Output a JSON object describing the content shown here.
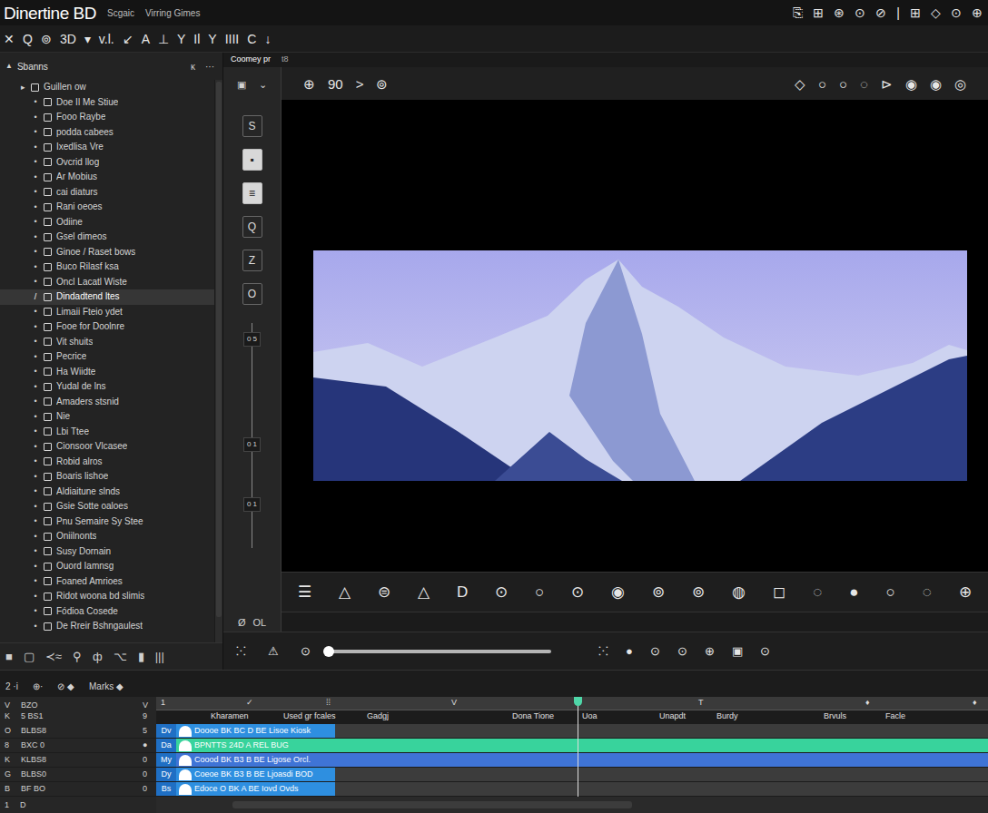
{
  "window": {
    "title": "Dinertine BD",
    "subtitle": "Scgaic",
    "menu": "Virring Gimes",
    "icons": [
      "⎘",
      "⊞",
      "⊛",
      "⊙",
      "⊘",
      "|",
      "⊞",
      "◇",
      "⊙",
      "⊕"
    ]
  },
  "toolbar": [
    "✕",
    "Q",
    "⊚",
    "3D",
    "▾",
    "v.l.",
    "↙",
    "A",
    "⊥",
    "Y",
    "Il",
    "Y",
    "IIII",
    "C",
    "↓"
  ],
  "sidebar": {
    "toggle": "▲",
    "title": "Sbanns",
    "actions": [
      "ĸ",
      "···"
    ],
    "items": [
      {
        "kind": "group",
        "marker": "▸",
        "label": "Guillen ow",
        "selected": false
      },
      {
        "kind": "item",
        "marker": "•",
        "label": "Doe Il Me Stiue",
        "selected": false
      },
      {
        "kind": "item",
        "marker": "•",
        "label": "Fooo Raybe",
        "selected": false
      },
      {
        "kind": "item",
        "marker": "•",
        "label": "podda cabees",
        "selected": false
      },
      {
        "kind": "item",
        "marker": "•",
        "label": "Ixedlisa Vre",
        "selected": false
      },
      {
        "kind": "item",
        "marker": "•",
        "label": "Ovcrid llog",
        "selected": false
      },
      {
        "kind": "item",
        "marker": "•",
        "label": "Ar Mobius",
        "selected": false
      },
      {
        "kind": "item",
        "marker": "•",
        "label": "cai diaturs",
        "selected": false
      },
      {
        "kind": "item",
        "marker": "•",
        "label": "Rani oeoes",
        "selected": false
      },
      {
        "kind": "item",
        "marker": "•",
        "label": "Odiine",
        "selected": false
      },
      {
        "kind": "item",
        "marker": "•",
        "label": "Gsel dimeos",
        "selected": false
      },
      {
        "kind": "item",
        "marker": "•",
        "label": "Ginoe / Raset bows",
        "selected": false
      },
      {
        "kind": "item",
        "marker": "•",
        "label": "Buco Rilasf ksa",
        "selected": false
      },
      {
        "kind": "item",
        "marker": "•",
        "label": "Oncl Lacatl Wiste",
        "selected": false
      },
      {
        "kind": "item",
        "marker": "/",
        "label": "Dindadtend ltes",
        "selected": true
      },
      {
        "kind": "item",
        "marker": "•",
        "label": "Limaii Fteio ydet",
        "selected": false
      },
      {
        "kind": "item",
        "marker": "•",
        "label": "Fooe for Doolnre",
        "selected": false
      },
      {
        "kind": "item",
        "marker": "•",
        "label": "Vit shuits",
        "selected": false
      },
      {
        "kind": "item",
        "marker": "•",
        "label": "Pecrice",
        "selected": false
      },
      {
        "kind": "item",
        "marker": "•",
        "label": "Ha Wiidte",
        "selected": false
      },
      {
        "kind": "item",
        "marker": "•",
        "label": "Yudal de lns",
        "selected": false
      },
      {
        "kind": "item",
        "marker": "•",
        "label": "Amaders stsnid",
        "selected": false
      },
      {
        "kind": "item",
        "marker": "•",
        "label": "Nie",
        "selected": false
      },
      {
        "kind": "item",
        "marker": "•",
        "label": "Lbi Ttee",
        "selected": false
      },
      {
        "kind": "item",
        "marker": "•",
        "label": "Cionsoor Vlcasee",
        "selected": false
      },
      {
        "kind": "item",
        "marker": "•",
        "label": "Robid alros",
        "selected": false
      },
      {
        "kind": "item",
        "marker": "•",
        "label": "Boaris lishoe",
        "selected": false
      },
      {
        "kind": "item",
        "marker": "•",
        "label": "Aldiaitune slnds",
        "selected": false
      },
      {
        "kind": "item",
        "marker": "•",
        "label": "Gsie Sotte oaloes",
        "selected": false
      },
      {
        "kind": "item",
        "marker": "•",
        "label": "Pnu Semaire Sy Stee",
        "selected": false
      },
      {
        "kind": "item",
        "marker": "•",
        "label": "Oniilnonts",
        "selected": false
      },
      {
        "kind": "item",
        "marker": "•",
        "label": "Susy Dornain",
        "selected": false
      },
      {
        "kind": "item",
        "marker": "•",
        "label": "Ouord Iamnsg",
        "selected": false
      },
      {
        "kind": "item",
        "marker": "•",
        "label": "Foaned Amrioes",
        "selected": false
      },
      {
        "kind": "item",
        "marker": "•",
        "label": "Ridot woona bd slimis",
        "selected": false
      },
      {
        "kind": "item",
        "marker": "•",
        "label": "Fódioa Cosede",
        "selected": false
      },
      {
        "kind": "item",
        "marker": "•",
        "label": "De Rreir Bshngaulest",
        "selected": false
      }
    ],
    "footer": [
      "■",
      "▢",
      "≺≈",
      "⚲",
      "ф",
      "⌥",
      "▮",
      "|||"
    ]
  },
  "viewer_tab": {
    "label": "Coomey pr",
    "extra": "t8"
  },
  "tools": {
    "header": [
      "▣",
      "⌄"
    ],
    "buttons": [
      {
        "label": "S",
        "selected": false
      },
      {
        "label": "▪",
        "selected": true
      },
      {
        "label": "≡",
        "selected": true
      },
      {
        "label": "Q",
        "selected": false
      },
      {
        "label": "Z",
        "selected": false
      },
      {
        "label": "O",
        "selected": false
      }
    ],
    "readings": [
      "0 5",
      "0 1",
      "0 1"
    ],
    "footer": [
      "Ø",
      "OL"
    ]
  },
  "viewer": {
    "toolbar_left": [
      "⊕",
      "90",
      ">",
      "⊚"
    ],
    "toolbar_right": [
      "◇",
      "○",
      "○",
      "◌",
      "⊳",
      "◉",
      "◉",
      "◎"
    ],
    "controls": [
      "☰",
      "△",
      "⊜",
      "△",
      "D",
      "⊙",
      "○",
      "⊙",
      "◉",
      "⊚",
      "⊚",
      "◍",
      "◻",
      "◌",
      "●",
      "○",
      "◌",
      "⊕"
    ]
  },
  "transport": {
    "left": [
      "⁙",
      "⚠",
      "⊙"
    ],
    "scrub": {
      "level": 0.01
    },
    "right": [
      "⁙",
      "●",
      "⊙",
      "⊙",
      "⊕",
      "▣",
      "⊙"
    ]
  },
  "timeline": {
    "header": [
      "2 ·i",
      "⊕·",
      "⊘ ◆",
      "Marks ◆"
    ],
    "ruler_left": [
      {
        "letter": "V",
        "name": "BZO",
        "flag": "V"
      },
      {
        "letter": "K",
        "name": "5 BS1",
        "flag": "9"
      }
    ],
    "ticks": [
      "1",
      "✓",
      "⁞⁞",
      "V",
      "T",
      "♦",
      "♦"
    ],
    "columns": [
      "Kharamen",
      "Used gr fcales",
      "Gadgj",
      "Dona Tione",
      "Uoa",
      "Unapdt",
      "Burdy",
      "Brvuls",
      "Facle"
    ],
    "tracks": [
      {
        "letter": "O",
        "name": "BLBS8",
        "flag": "5",
        "tag": "Dv",
        "clip": "Doooe BK BC D BE  Lisoe Kiosk",
        "color": "#2e8fe0",
        "extended": false
      },
      {
        "letter": "8",
        "name": "BXC 0",
        "flag": "●",
        "tag": "Da",
        "clip": "BPNTTS  24D A REL BUG",
        "color": "#38d39c",
        "extended": true
      },
      {
        "letter": "K",
        "name": "KLBS8",
        "flag": "0",
        "tag": "My",
        "clip": "Coood BK B3 B BE Ligose Orcl.",
        "color": "#3f74d6",
        "extended": true
      },
      {
        "letter": "G",
        "name": "BLBS0",
        "flag": "0",
        "tag": "Dy",
        "clip": "Coeoe BK B3 B BE Ljoasdi BOD",
        "color": "#2e8fe0",
        "extended": false
      },
      {
        "letter": "B",
        "name": "BF BO",
        "flag": "0",
        "tag": "Bs",
        "clip": "Edoce O BK A BE Iovd Ovds",
        "color": "#2e8fe0",
        "extended": false
      }
    ],
    "footer": [
      "1",
      "D"
    ],
    "playhead": {
      "level": 0.507
    }
  }
}
